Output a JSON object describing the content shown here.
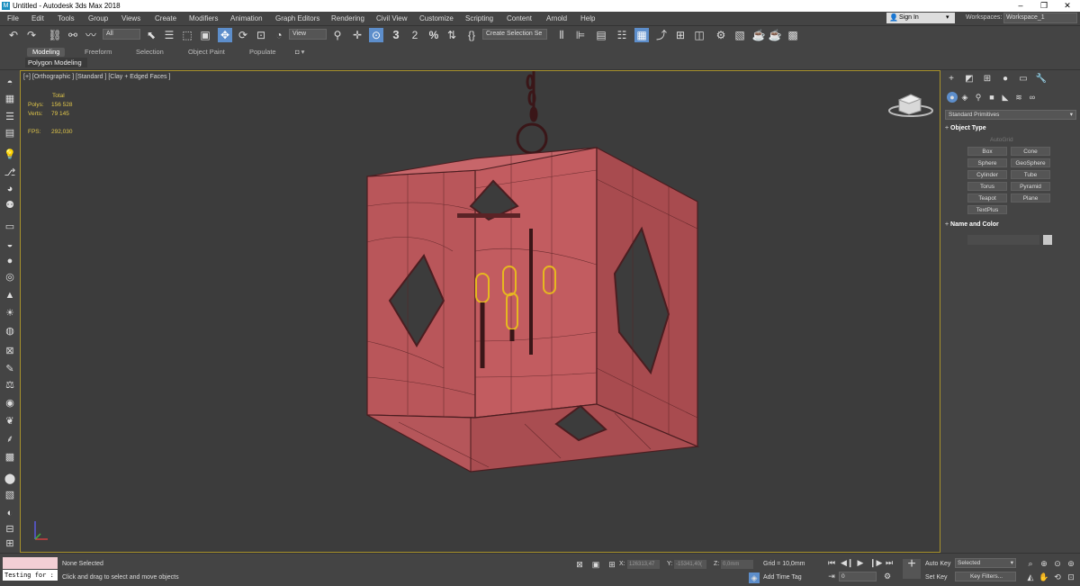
{
  "window": {
    "title": "Untitled - Autodesk 3ds Max 2018",
    "app_icon": "3ds-max-logo"
  },
  "menu": {
    "items": [
      "File",
      "Edit",
      "Tools",
      "Group",
      "Views",
      "Create",
      "Modifiers",
      "Animation",
      "Graph Editors",
      "Rendering",
      "Civil View",
      "Customize",
      "Scripting",
      "Content",
      "Arnold",
      "Help"
    ],
    "sign_in": "Sign In",
    "workspaces_label": "Workspaces:",
    "workspace_value": "Workspace_1"
  },
  "toolbar": {
    "filter_value": "All",
    "reference_coord": "View",
    "selection_set_placeholder": "Create Selection Se",
    "snap_label": "3",
    "angle_snap_label": "2",
    "percent_snap_label": "%"
  },
  "ribbon": {
    "tabs": [
      "Modeling",
      "Freeform",
      "Selection",
      "Object Paint",
      "Populate"
    ],
    "active_tab": "Modeling",
    "sub_label": "Polygon Modeling"
  },
  "viewport": {
    "label": "[+] [Orthographic ] [Standard ] [Clay + Edged Faces ]",
    "stats": {
      "header": "Total",
      "polys_label": "Polys:",
      "polys_value": "156 528",
      "verts_label": "Verts:",
      "verts_value": "79 145",
      "fps_label": "FPS:",
      "fps_value": "292,030"
    }
  },
  "command_panel": {
    "dropdown": "Standard Primitives",
    "object_type_title": "Object Type",
    "autogrid_label": "AutoGrid",
    "primitives": [
      "Box",
      "Cone",
      "Sphere",
      "GeoSphere",
      "Cylinder",
      "Tube",
      "Torus",
      "Pyramid",
      "Teapot",
      "Plane",
      "TextPlus"
    ],
    "name_color_title": "Name and Color"
  },
  "status": {
    "maxscript_value": "Testing for :",
    "selected_text": "None Selected",
    "prompt_text": "Click and drag to select and move objects",
    "x_label": "X:",
    "x_value": "126313,47",
    "y_label": "Y:",
    "y_value": "-15341,40(",
    "z_label": "Z:",
    "z_value": "0,0mm",
    "grid_text": "Grid = 10,0mm",
    "add_time_tag": "Add Time Tag",
    "frame_value": "0",
    "auto_key": "Auto Key",
    "set_key": "Set Key",
    "selected_value": "Selected",
    "key_filters": "Key Filters..."
  },
  "colors": {
    "accent": "#5d8ecb",
    "model_fill": "#b9565a",
    "viewport_border": "#a8922c",
    "stats_text": "#e0c64a"
  }
}
